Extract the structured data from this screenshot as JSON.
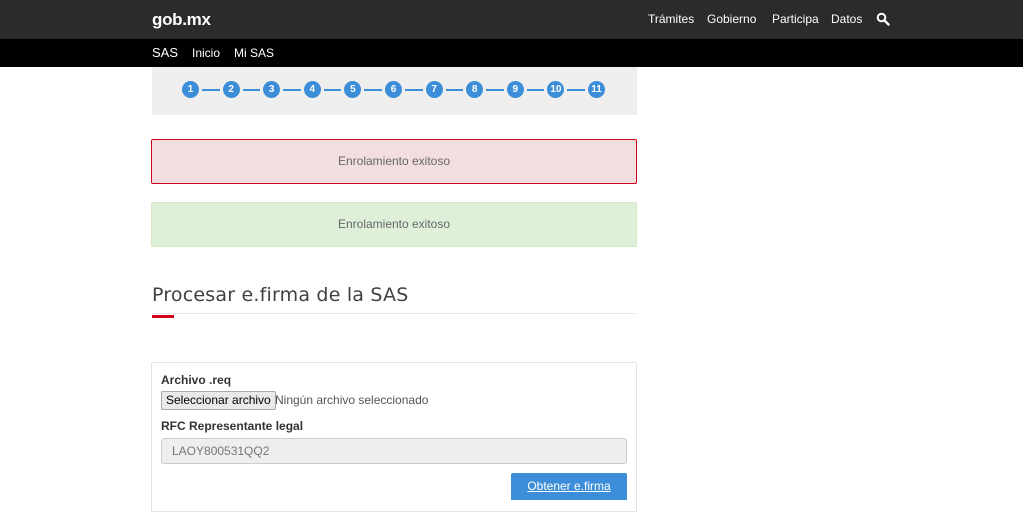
{
  "header": {
    "logo": "gob.mx",
    "nav": [
      "Trámites",
      "Gobierno",
      "Participa",
      "Datos"
    ],
    "search_icon": "search-icon"
  },
  "subnav": {
    "brand": "SAS",
    "items": [
      "Inicio",
      "Mi SAS"
    ]
  },
  "steps": {
    "items": [
      "1",
      "2",
      "3",
      "4",
      "5",
      "6",
      "7",
      "8",
      "9",
      "10",
      "11"
    ],
    "color": "#3d8ed8"
  },
  "alerts": {
    "danger": "Enrolamiento exitoso",
    "success": "Enrolamiento exitoso"
  },
  "section": {
    "title": "Procesar e.firma de la SAS"
  },
  "form": {
    "file_label": "Archivo .req",
    "file_button": "Seleccionar archivo",
    "file_status": "Ningún archivo seleccionado",
    "rfc_label": "RFC Representante legal",
    "rfc_value": "LAOY800531QQ2",
    "submit": "Obtener e.firma"
  },
  "colors": {
    "accent": "#d0021b",
    "primary": "#3d8ed8",
    "header": "#2b2b2b"
  }
}
